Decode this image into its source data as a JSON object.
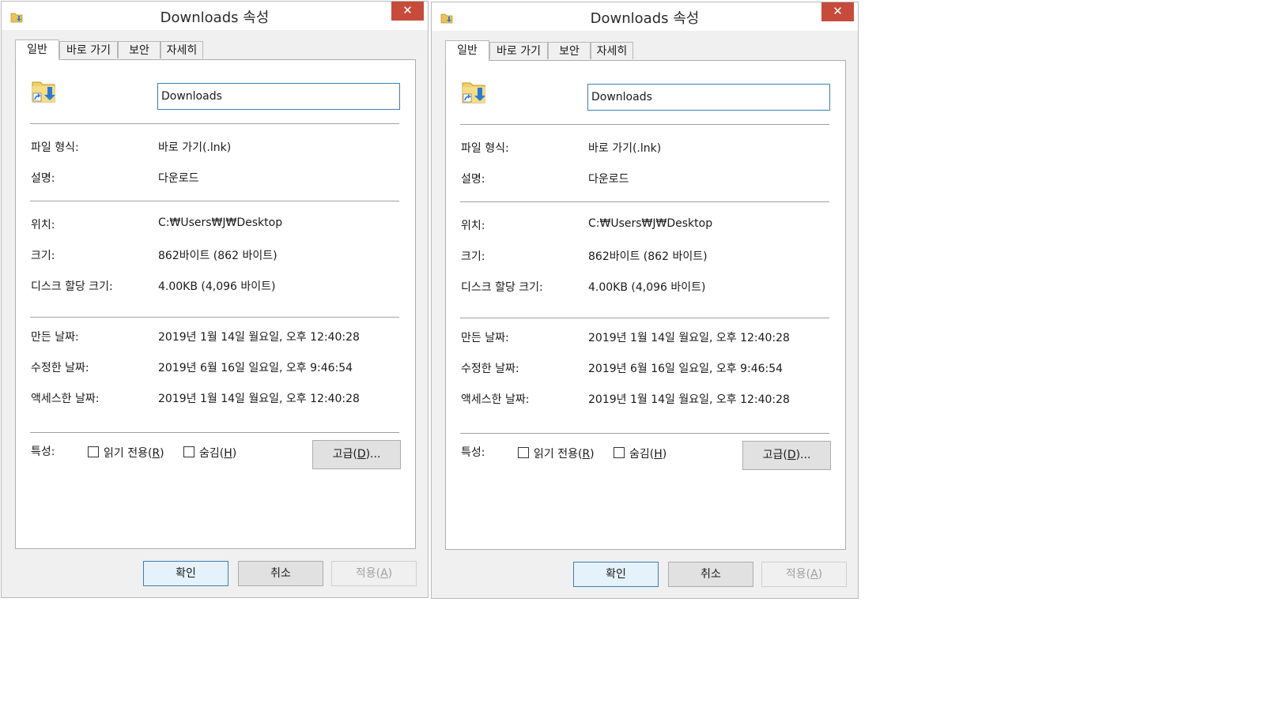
{
  "dialogs": [
    {
      "title": "Downloads 속성",
      "close_glyph": "✕",
      "tabs": [
        "일반",
        "바로 가기",
        "보안",
        "자세히"
      ],
      "name_value": "Downloads",
      "rows": {
        "file_type_label": "파일 형식:",
        "file_type_value": "바로 가기(.lnk)",
        "description_label": "설명:",
        "description_value": "다운로드",
        "location_label": "위치:",
        "location_value": "C:₩Users₩J₩Desktop",
        "size_label": "크기:",
        "size_value": "862바이트 (862 바이트)",
        "disk_size_label": "디스크 할당 크기:",
        "disk_size_value": "4.00KB (4,096 바이트)",
        "created_label": "만든 날짜:",
        "created_value": "2019년 1월 14일 월요일, 오후 12:40:28",
        "modified_label": "수정한 날짜:",
        "modified_value": "2019년 6월 16일 일요일, 오후 9:46:54",
        "accessed_label": "액세스한 날짜:",
        "accessed_value": "2019년 1월 14일 월요일, 오후 12:40:28"
      },
      "attributes": {
        "label": "특성:",
        "readonly_text": "읽기 전용(",
        "readonly_key": "R",
        "readonly_end": ")",
        "hidden_text": "숨김(",
        "hidden_key": "H",
        "hidden_end": ")",
        "advanced_text": "고급(",
        "advanced_key": "D",
        "advanced_end": ")..."
      },
      "buttons": {
        "ok": "확인",
        "cancel": "취소",
        "apply_text": "적용(",
        "apply_key": "A",
        "apply_end": ")"
      }
    },
    {
      "title": "Downloads 속성",
      "close_glyph": "✕",
      "tabs": [
        "일반",
        "바로 가기",
        "보안",
        "자세히"
      ],
      "name_value": "Downloads",
      "rows": {
        "file_type_label": "파일 형식:",
        "file_type_value": "바로 가기(.lnk)",
        "description_label": "설명:",
        "description_value": "다운로드",
        "location_label": "위치:",
        "location_value": "C:₩Users₩J₩Desktop",
        "size_label": "크기:",
        "size_value": "862바이트 (862 바이트)",
        "disk_size_label": "디스크 할당 크기:",
        "disk_size_value": "4.00KB (4,096 바이트)",
        "created_label": "만든 날짜:",
        "created_value": "2019년 1월 14일 월요일, 오후 12:40:28",
        "modified_label": "수정한 날짜:",
        "modified_value": "2019년 6월 16일 일요일, 오후 9:46:54",
        "accessed_label": "액세스한 날짜:",
        "accessed_value": "2019년 1월 14일 월요일, 오후 12:40:28"
      },
      "attributes": {
        "label": "특성:",
        "readonly_text": "읽기 전용(",
        "readonly_key": "R",
        "readonly_end": ")",
        "hidden_text": "숨김(",
        "hidden_key": "H",
        "hidden_end": ")",
        "advanced_text": "고급(",
        "advanced_key": "D",
        "advanced_end": ")..."
      },
      "buttons": {
        "ok": "확인",
        "cancel": "취소",
        "apply_text": "적용(",
        "apply_key": "A",
        "apply_end": ")"
      }
    }
  ],
  "icons": {
    "title_icon": "shortcut-folder-icon",
    "file_icon": "shortcut-folder-icon"
  },
  "colors": {
    "close_button": "#c74b3a",
    "focus_border": "#3c7fb1"
  }
}
